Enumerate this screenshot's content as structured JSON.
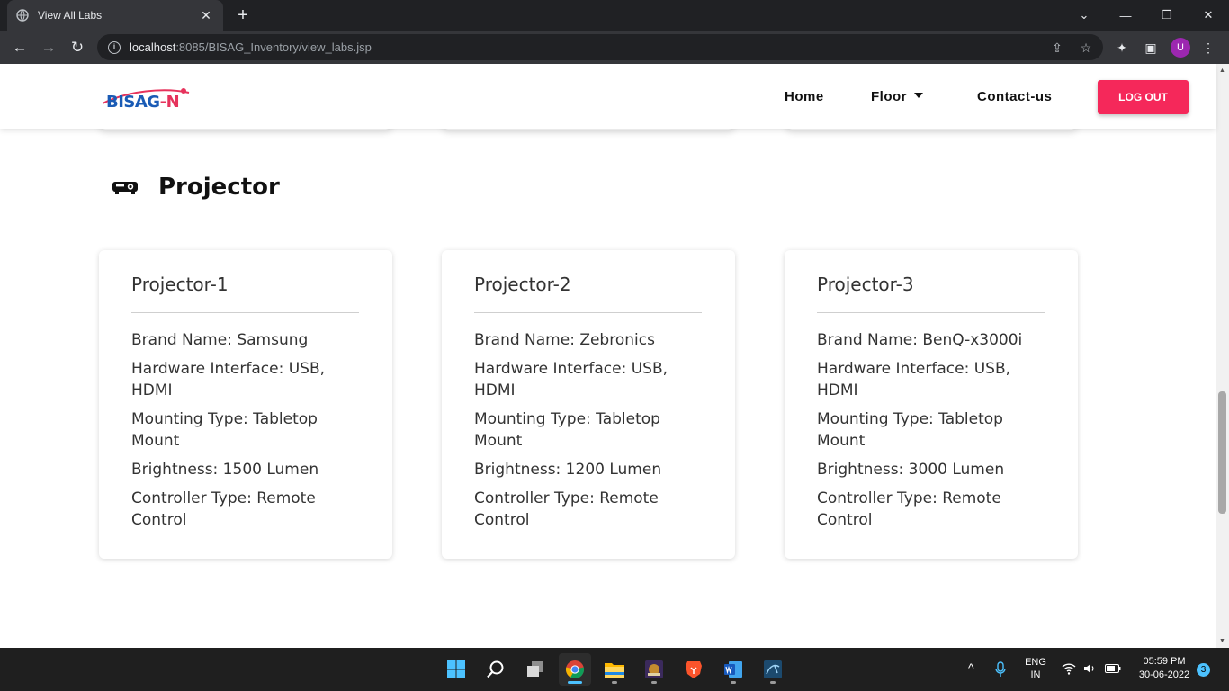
{
  "browser": {
    "tab_title": "View All Labs",
    "url_host": "localhost",
    "url_rest": ":8085/BISAG_Inventory/view_labs.jsp",
    "profile_initial": "U"
  },
  "navbar": {
    "logo_left": "BISAG",
    "logo_right": "-N",
    "links": [
      "Home",
      "Floor",
      "Contact-us"
    ],
    "logout_label": "LOG OUT"
  },
  "section": {
    "title": "Projector",
    "icon": "projector-icon"
  },
  "cards": [
    {
      "title": "Projector-1",
      "specs": [
        "Brand Name: Samsung",
        "Hardware Interface: USB, HDMI",
        "Mounting Type: Tabletop Mount",
        "Brightness: 1500 Lumen",
        "Controller Type: Remote Control"
      ]
    },
    {
      "title": "Projector-2",
      "specs": [
        "Brand Name: Zebronics",
        "Hardware Interface: USB, HDMI",
        "Mounting Type: Tabletop Mount",
        "Brightness: 1200 Lumen",
        "Controller Type: Remote Control"
      ]
    },
    {
      "title": "Projector-3",
      "specs": [
        "Brand Name: BenQ-x3000i",
        "Hardware Interface: USB, HDMI",
        "Mounting Type: Tabletop Mount",
        "Brightness: 3000 Lumen",
        "Controller Type: Remote Control"
      ]
    }
  ],
  "taskbar": {
    "lang_top": "ENG",
    "lang_bottom": "IN",
    "time": "05:59 PM",
    "date": "30-06-2022",
    "notification_count": "3"
  },
  "colors": {
    "accent": "#f5285a",
    "logo_blue": "#1a5bb5"
  }
}
